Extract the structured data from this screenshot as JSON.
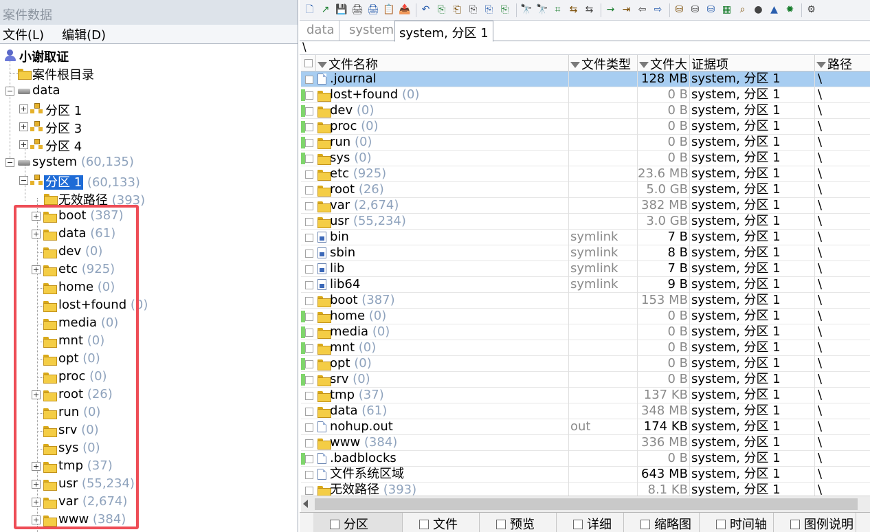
{
  "left": {
    "title": "案件数据",
    "menu": [
      "文件(L)",
      "编辑(D)"
    ],
    "tree": {
      "root": "小谢取证",
      "case_root": "案件根目录",
      "data_drive": "data",
      "data_parts": [
        "分区 1",
        "分区 3",
        "分区 4"
      ],
      "system_drive": "system",
      "system_count": "(60,135)",
      "partition_label": "分区 1",
      "partition_count": "(60,133)",
      "invalid_label": "无效路径",
      "invalid_count": "(393)",
      "folders": [
        {
          "name": "boot",
          "count": "(387)"
        },
        {
          "name": "data",
          "count": "(61)"
        },
        {
          "name": "dev",
          "count": "(0)"
        },
        {
          "name": "etc",
          "count": "(925)"
        },
        {
          "name": "home",
          "count": "(0)"
        },
        {
          "name": "lost+found",
          "count": "(0)"
        },
        {
          "name": "media",
          "count": "(0)"
        },
        {
          "name": "mnt",
          "count": "(0)"
        },
        {
          "name": "opt",
          "count": "(0)"
        },
        {
          "name": "proc",
          "count": "(0)"
        },
        {
          "name": "root",
          "count": "(26)"
        },
        {
          "name": "run",
          "count": "(0)"
        },
        {
          "name": "srv",
          "count": "(0)"
        },
        {
          "name": "sys",
          "count": "(0)"
        },
        {
          "name": "tmp",
          "count": "(37)"
        },
        {
          "name": "usr",
          "count": "(55,234)"
        },
        {
          "name": "var",
          "count": "(2,674)"
        },
        {
          "name": "www",
          "count": "(384)"
        }
      ]
    }
  },
  "right": {
    "tabs": [
      "data",
      "system",
      "system, 分区 1"
    ],
    "path": "\\",
    "columns": [
      "文件名称",
      "文件类型",
      "文件大",
      "证据项",
      "路径"
    ],
    "rows": [
      {
        "name": ".journal",
        "count": "",
        "type": "",
        "size": "128 MB",
        "evidence": "system, 分区 1",
        "path": "\\",
        "icon": "file",
        "green": false,
        "selected": true
      },
      {
        "name": "lost+found",
        "count": "(0)",
        "type": "",
        "size": "0 B",
        "evidence": "system, 分区 1",
        "path": "\\",
        "icon": "folder",
        "green": true
      },
      {
        "name": "dev",
        "count": "(0)",
        "type": "",
        "size": "0 B",
        "evidence": "system, 分区 1",
        "path": "\\",
        "icon": "folder",
        "green": true
      },
      {
        "name": "proc",
        "count": "(0)",
        "type": "",
        "size": "0 B",
        "evidence": "system, 分区 1",
        "path": "\\",
        "icon": "folder",
        "green": true
      },
      {
        "name": "run",
        "count": "(0)",
        "type": "",
        "size": "0 B",
        "evidence": "system, 分区 1",
        "path": "\\",
        "icon": "folder",
        "green": true
      },
      {
        "name": "sys",
        "count": "(0)",
        "type": "",
        "size": "0 B",
        "evidence": "system, 分区 1",
        "path": "\\",
        "icon": "folder",
        "green": true
      },
      {
        "name": "etc",
        "count": "(925)",
        "type": "",
        "size": "23.6 MB",
        "evidence": "system, 分区 1",
        "path": "\\",
        "icon": "folder",
        "green": false
      },
      {
        "name": "root",
        "count": "(26)",
        "type": "",
        "size": "5.0 GB",
        "evidence": "system, 分区 1",
        "path": "\\",
        "icon": "folder",
        "green": false
      },
      {
        "name": "var",
        "count": "(2,674)",
        "type": "",
        "size": "382 MB",
        "evidence": "system, 分区 1",
        "path": "\\",
        "icon": "folder",
        "green": false
      },
      {
        "name": "usr",
        "count": "(55,234)",
        "type": "",
        "size": "3.0 GB",
        "evidence": "system, 分区 1",
        "path": "\\",
        "icon": "folder",
        "green": false
      },
      {
        "name": "bin",
        "count": "",
        "type": "symlink",
        "size": "7 B",
        "evidence": "system, 分区 1",
        "path": "\\",
        "icon": "link",
        "green": false,
        "dark": true
      },
      {
        "name": "sbin",
        "count": "",
        "type": "symlink",
        "size": "8 B",
        "evidence": "system, 分区 1",
        "path": "\\",
        "icon": "link",
        "green": false,
        "dark": true
      },
      {
        "name": "lib",
        "count": "",
        "type": "symlink",
        "size": "7 B",
        "evidence": "system, 分区 1",
        "path": "\\",
        "icon": "link",
        "green": false,
        "dark": true
      },
      {
        "name": "lib64",
        "count": "",
        "type": "symlink",
        "size": "9 B",
        "evidence": "system, 分区 1",
        "path": "\\",
        "icon": "link",
        "green": false,
        "dark": true
      },
      {
        "name": "boot",
        "count": "(387)",
        "type": "",
        "size": "153 MB",
        "evidence": "system, 分区 1",
        "path": "\\",
        "icon": "folder",
        "green": false
      },
      {
        "name": "home",
        "count": "(0)",
        "type": "",
        "size": "0 B",
        "evidence": "system, 分区 1",
        "path": "\\",
        "icon": "folder",
        "green": true
      },
      {
        "name": "media",
        "count": "(0)",
        "type": "",
        "size": "0 B",
        "evidence": "system, 分区 1",
        "path": "\\",
        "icon": "folder",
        "green": true
      },
      {
        "name": "mnt",
        "count": "(0)",
        "type": "",
        "size": "0 B",
        "evidence": "system, 分区 1",
        "path": "\\",
        "icon": "folder",
        "green": true
      },
      {
        "name": "opt",
        "count": "(0)",
        "type": "",
        "size": "0 B",
        "evidence": "system, 分区 1",
        "path": "\\",
        "icon": "folder",
        "green": true
      },
      {
        "name": "srv",
        "count": "(0)",
        "type": "",
        "size": "0 B",
        "evidence": "system, 分区 1",
        "path": "\\",
        "icon": "folder",
        "green": true
      },
      {
        "name": "tmp",
        "count": "(37)",
        "type": "",
        "size": "137 KB",
        "evidence": "system, 分区 1",
        "path": "\\",
        "icon": "folder",
        "green": false
      },
      {
        "name": "data",
        "count": "(61)",
        "type": "",
        "size": "348 MB",
        "evidence": "system, 分区 1",
        "path": "\\",
        "icon": "folder",
        "green": false
      },
      {
        "name": "nohup.out",
        "count": "",
        "type": "out",
        "size": "174 KB",
        "evidence": "system, 分区 1",
        "path": "\\",
        "icon": "file",
        "green": false,
        "dark": true
      },
      {
        "name": "www",
        "count": "(384)",
        "type": "",
        "size": "336 MB",
        "evidence": "system, 分区 1",
        "path": "\\",
        "icon": "folder",
        "green": false
      },
      {
        "name": ".badblocks",
        "count": "",
        "type": "",
        "size": "0 B",
        "evidence": "system, 分区 1",
        "path": "\\",
        "icon": "file",
        "green": true
      },
      {
        "name": "文件系统区域",
        "count": "",
        "type": "",
        "size": "643 MB",
        "evidence": "system, 分区 1",
        "path": "\\",
        "icon": "file",
        "green": false,
        "dark": true
      },
      {
        "name": "无效路径",
        "count": "(393)",
        "type": "",
        "size": "8.1 KB",
        "evidence": "system, 分区 1",
        "path": "\\",
        "icon": "folder",
        "green": false
      }
    ],
    "bottom_tabs": [
      "分区",
      "文件",
      "预览",
      "详细",
      "缩略图",
      "时间轴",
      "图例说明"
    ]
  },
  "colors": {
    "accent": "#1e6bd6",
    "selection": "#a7cdf1",
    "count_text": "#8fa3bd",
    "highlight_box": "#ee4d56",
    "green_mark": "#7fd56c"
  },
  "icons": [
    "new-file-icon",
    "open-icon",
    "save-icon",
    "print-icon",
    "undo-icon",
    "copy-icon",
    "paste-icon",
    "find-icon",
    "hex-find-icon",
    "goto-icon",
    "back-icon",
    "forward-icon",
    "disk-icon",
    "search-icon",
    "settings-icon"
  ]
}
